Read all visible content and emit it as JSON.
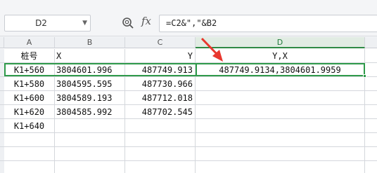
{
  "formula_bar": {
    "name_box": "D2",
    "formula": "=C2&\",\"&B2"
  },
  "columns": [
    "A",
    "B",
    "C",
    "D"
  ],
  "active_column": "D",
  "rows": [
    {
      "a": "桩号",
      "b": "X",
      "c": "Y",
      "d": "Y,X"
    },
    {
      "a": "K1+560",
      "b": "3804601.996",
      "c": "487749.913",
      "d": "487749.9134,3804601.9959"
    },
    {
      "a": "K1+580",
      "b": "3804595.595",
      "c": "487730.966",
      "d": ""
    },
    {
      "a": "K1+600",
      "b": "3804589.193",
      "c": "487712.018",
      "d": ""
    },
    {
      "a": "K1+620",
      "b": "3804585.992",
      "c": "487702.545",
      "d": ""
    },
    {
      "a": "K1+640",
      "b": "",
      "c": "",
      "d": ""
    },
    {
      "a": "",
      "b": "",
      "c": "",
      "d": ""
    },
    {
      "a": "",
      "b": "",
      "c": "",
      "d": ""
    },
    {
      "a": "",
      "b": "",
      "c": "",
      "d": ""
    }
  ],
  "colors": {
    "selection": "#2f9a4a",
    "arrow": "#e8372e"
  }
}
